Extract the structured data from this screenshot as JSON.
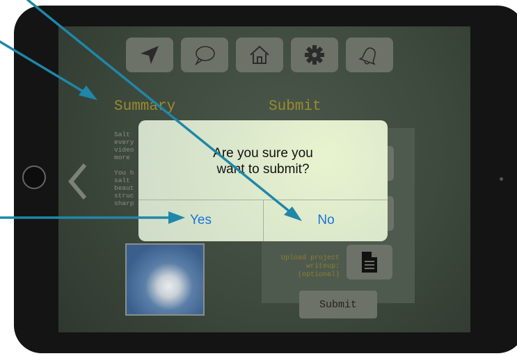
{
  "toolbar": {
    "buttons": [
      {
        "icon": "navigate-arrow-icon"
      },
      {
        "icon": "speech-bubble-icon"
      },
      {
        "icon": "home-icon"
      },
      {
        "icon": "gear-icon"
      },
      {
        "icon": "bell-icon"
      }
    ]
  },
  "summary": {
    "title": "Summary",
    "text_lines": [
      "Salt",
      "every",
      "video",
      "more",
      "",
      "You h",
      "salt",
      "beaut",
      "struc",
      "sharp"
    ]
  },
  "submit_panel": {
    "title": "Submit",
    "upload_label": "Upload project\nwriteup:\n(optional)",
    "submit_label": "Submit"
  },
  "dialog": {
    "message": "Are you sure you\nwant to submit?",
    "yes_label": "Yes",
    "no_label": "No",
    "button_color": "#1a73d9"
  },
  "colors": {
    "screen_bg": "#3f4b3f",
    "title_gold": "#9a8c2c",
    "annotation_line": "#1f87a8"
  }
}
